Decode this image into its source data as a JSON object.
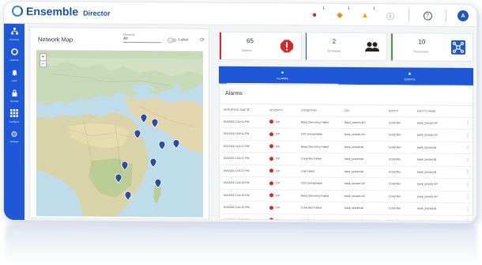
{
  "app": {
    "brand": "Ensemble",
    "product": "Director"
  },
  "topbar": {
    "icons": [
      {
        "name": "alarm-critical-icon",
        "glyph": "●",
        "color": "#d8262b",
        "badge": "1"
      },
      {
        "name": "alarm-major-icon",
        "glyph": "◆",
        "color": "#f08a24",
        "badge": "1"
      },
      {
        "name": "alarm-warning-icon",
        "glyph": "▲",
        "color": "#e0b000",
        "badge": "1"
      },
      {
        "name": "info-icon",
        "glyph": "ⓘ",
        "color": "#666666",
        "badge": ""
      },
      {
        "name": "help-icon",
        "glyph": "?",
        "color": "#555555",
        "badge": ""
      }
    ],
    "user_initial": "A"
  },
  "sidebar": {
    "items": [
      {
        "label": "Inventory",
        "icon": "network-tree-icon",
        "glyph": "⛫"
      },
      {
        "label": "Network",
        "icon": "network-icon",
        "glyph": "⊖"
      },
      {
        "label": "Fault",
        "icon": "bell-icon",
        "glyph": "🔔"
      },
      {
        "label": "Security",
        "icon": "lock-icon",
        "glyph": "🔒"
      },
      {
        "label": "Configure",
        "icon": "grid-icon",
        "glyph": "▦"
      },
      {
        "label": "Settings",
        "icon": "gear-icon",
        "glyph": "⚙"
      }
    ]
  },
  "map": {
    "title": "Network Map",
    "filter_label": "Elements",
    "filter_value": "All",
    "toggle_label": "Label"
  },
  "stats": [
    {
      "value": "65",
      "label": "Alarms",
      "color": "#d8262b",
      "icon": "alert-icon"
    },
    {
      "value": "2",
      "label": "Sessions",
      "color": "#1e57d6",
      "icon": "users-icon"
    },
    {
      "value": "10",
      "label": "Processes",
      "color": "#43a047",
      "icon": "topology-icon"
    }
  ],
  "tabs": [
    {
      "label": "ALARMS",
      "glyph": "●",
      "active": true
    },
    {
      "label": "EVENTS",
      "glyph": "▲",
      "active": false
    }
  ],
  "alarms": {
    "title": "Alarms",
    "columns": [
      "REPORTED TIME",
      "SEVERITY",
      "CONDITION",
      "CID",
      "ENTITY",
      "ENTITY NAME"
    ],
    "rows": [
      {
        "time": "6/4/2018 2:10:11 PM",
        "severity": "CR",
        "condition": "Beep Discovery Failed",
        "cid": "Bank_branch-NY",
        "entity": "Controller",
        "name": "bank_branch-NY"
      },
      {
        "time": "6/4/2018 2:09:11 PM",
        "severity": "CR",
        "condition": "CID Unreachable",
        "cid": "bank_branch-NY",
        "entity": "Controller",
        "name": "bank_branch-NY"
      },
      {
        "time": "6/4/2018 2:02:27 PM",
        "severity": "CR",
        "condition": "Beep Discovery Failed",
        "cid": "bank_branch48",
        "entity": "Controller",
        "name": "bank_branch48"
      },
      {
        "time": "6/4/2018 1:02:27 PM",
        "severity": "CR",
        "condition": "Controller Failed",
        "cid": "bank_branch48",
        "entity": "Controller",
        "name": "bank_branch48"
      },
      {
        "time": "6/4/2018 1:05:27 PM",
        "severity": "CR",
        "condition": "Link Failed",
        "cid": "bank_branch48",
        "entity": "Controller",
        "name": "bank_branch48"
      },
      {
        "time": "6/4/2018 1:02:25 PM",
        "severity": "CR",
        "condition": "CID Unreachable",
        "cid": "bank_branch-NY",
        "entity": "Controller",
        "name": "bank_branch-NY"
      },
      {
        "time": "6/4/2018 1:02:25 PM",
        "severity": "CR",
        "condition": "Beep Discovery Failed",
        "cid": "bank_branch-NY",
        "entity": "Controller",
        "name": "bank_branch-NY"
      },
      {
        "time": "6/4/2018 1:02:25 PM",
        "severity": "CR",
        "condition": "Controller Failed",
        "cid": "bank_branch48",
        "entity": "Controller",
        "name": "bank_branch48"
      },
      {
        "time": "6/4/2018 1:02:25 PM",
        "severity": "CR",
        "condition": "Link Failed",
        "cid": "bank_branch48",
        "entity": "Controller",
        "name": "bank_branch48"
      }
    ]
  }
}
